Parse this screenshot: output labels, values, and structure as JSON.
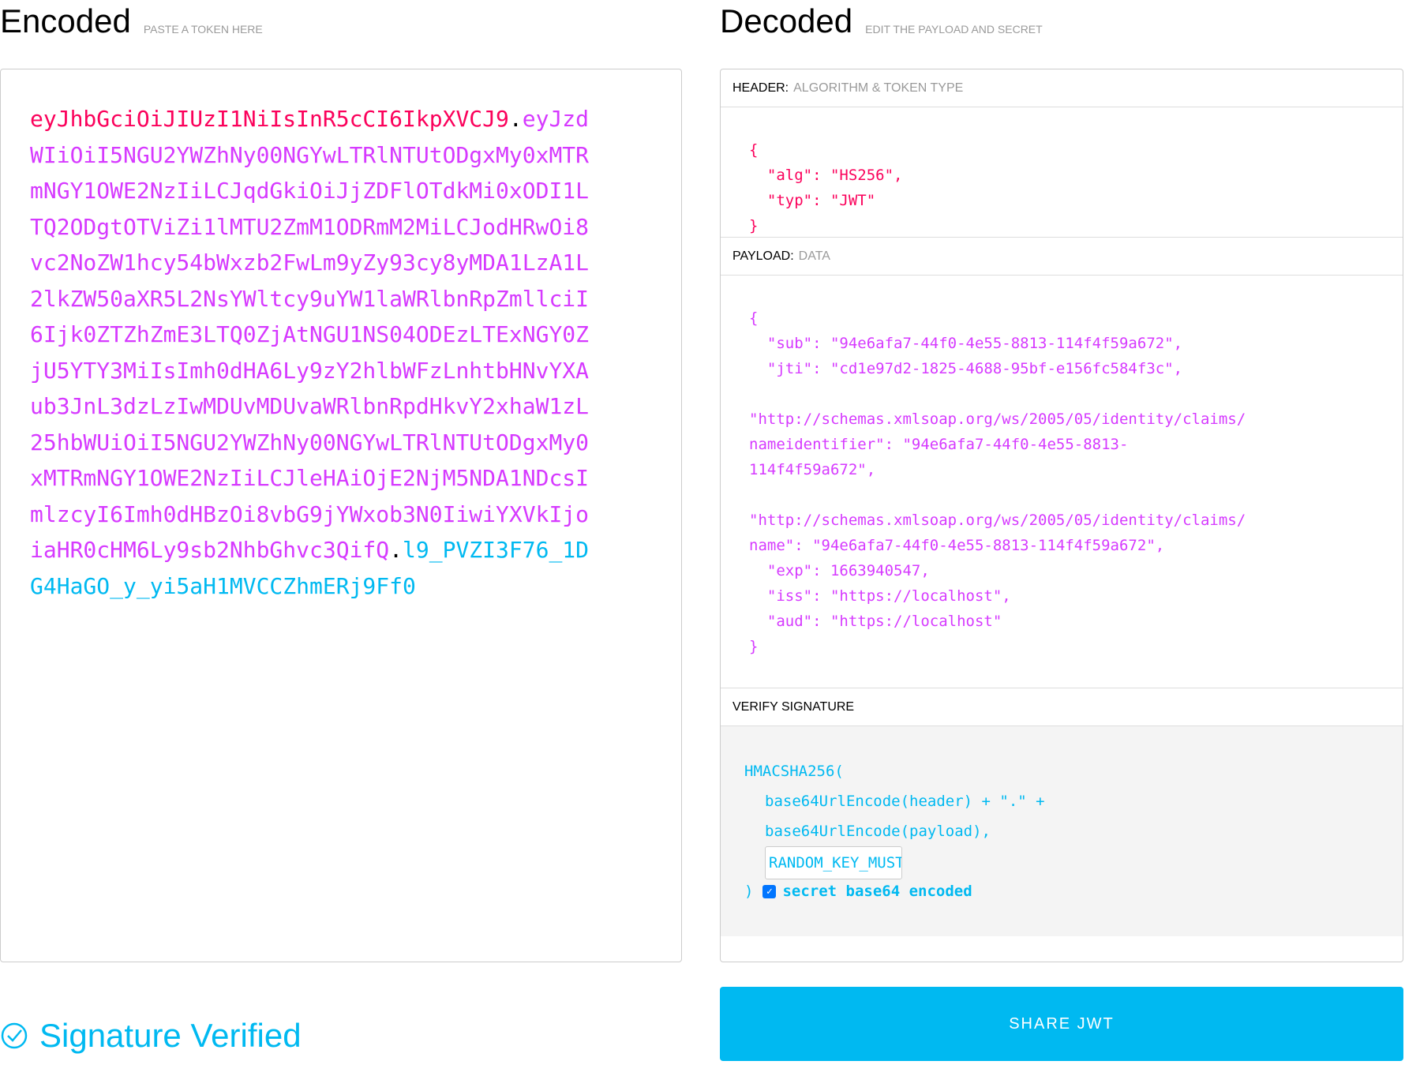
{
  "encoded": {
    "title": "Encoded",
    "subtitle": "PASTE A TOKEN HERE",
    "token_header": "eyJhbGciOiJIUzI1NiIsInR5cCI6IkpXVCJ9",
    "token_payload": "eyJzdWIiOiI5NGU2YWZhNy00NGYwLTRlNTUtODgxMy0xMTRmNGY1OWE2NzIiLCJqdGkiOiJjZDFlOTdkMi0xODI1LTQ2ODgtOTViZi1lMTU2ZmM1ODRmM2MiLCJodHRwOi8vc2NoZW1hcy54bWxzb2FwLm9yZy93cy8yMDA1LzA1L2lkZW50aXR5L2NsYWltcy9uYW1laWRlbnRpZmllciI6Ijk0ZTZhZmE3LTQ0ZjAtNGU1NS04ODEzLTExNGY0ZjU5YTY3MiIsImh0dHA6Ly9zY2hlbWFzLnhtbHNvYXAub3JnL3dzLzIwMDUvMDUvaWRlbnRpdHkvY2xhaW1zL25hbWUiOiI5NGU2YWZhNy00NGYwLTRlNTUtODgxMy0xMTRmNGY1OWE2NzIiLCJleHAiOjE2NjM5NDA1NDcsImlzcyI6Imh0dHBzOi8vbG9jYWxob3N0IiwiYXVkIjoiaHR0cHM6Ly9sb2NhbGhvc3QifQ",
    "token_signature": "l9_PVZI3F76_1DG4HaGO_y_yi5aH1MVCCZhmERj9Ff0",
    "dot": "."
  },
  "decoded": {
    "title": "Decoded",
    "subtitle": "EDIT THE PAYLOAD AND SECRET",
    "header_section": {
      "label": "HEADER:",
      "sublabel": "ALGORITHM & TOKEN TYPE",
      "json": "{\n  \"alg\": \"HS256\",\n  \"typ\": \"JWT\"\n}"
    },
    "payload_section": {
      "label": "PAYLOAD:",
      "sublabel": "DATA",
      "json": "{\n  \"sub\": \"94e6afa7-44f0-4e55-8813-114f4f59a672\",\n  \"jti\": \"cd1e97d2-1825-4688-95bf-e156fc584f3c\",\n\n\"http://schemas.xmlsoap.org/ws/2005/05/identity/claims/\nnameidentifier\": \"94e6afa7-44f0-4e55-8813-\n114f4f59a672\",\n\n\"http://schemas.xmlsoap.org/ws/2005/05/identity/claims/\nname\": \"94e6afa7-44f0-4e55-8813-114f4f59a672\",\n  \"exp\": 1663940547,\n  \"iss\": \"https://localhost\",\n  \"aud\": \"https://localhost\"\n}"
    },
    "signature_section": {
      "label": "VERIFY SIGNATURE",
      "line1": "HMACSHA256(",
      "line2": "base64UrlEncode(header) + \".\" +",
      "line3": "base64UrlEncode(payload),",
      "secret_value": "RANDOM_KEY_MUST_NOT_BE",
      "close_paren": ")",
      "checkbox_checked": true,
      "checkbox_label": "secret base64 encoded"
    }
  },
  "footer": {
    "status": "Signature Verified",
    "share_button": "SHARE JWT"
  },
  "colors": {
    "header": "#fb015b",
    "payload": "#d63aff",
    "signature": "#00b9f1",
    "button": "#00b9f1"
  }
}
